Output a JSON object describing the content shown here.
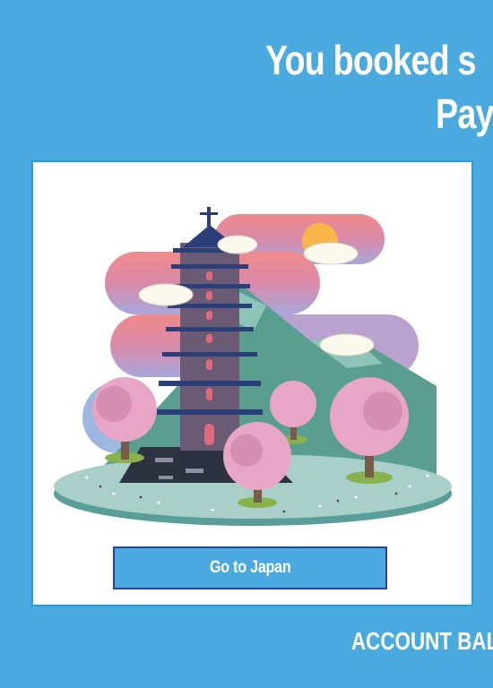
{
  "header": {
    "headline": "You booked s",
    "subhead": "Pay"
  },
  "card": {
    "illustration_icon": "japanese-pagoda-landscape-icon",
    "cta_label": "Go to Japan"
  },
  "footer": {
    "balance_label": "ACCOUNT BAL"
  },
  "colors": {
    "background": "#4aaae0",
    "card_border": "#1fa0df",
    "button_border": "#25459a",
    "text": "#ffffff"
  }
}
